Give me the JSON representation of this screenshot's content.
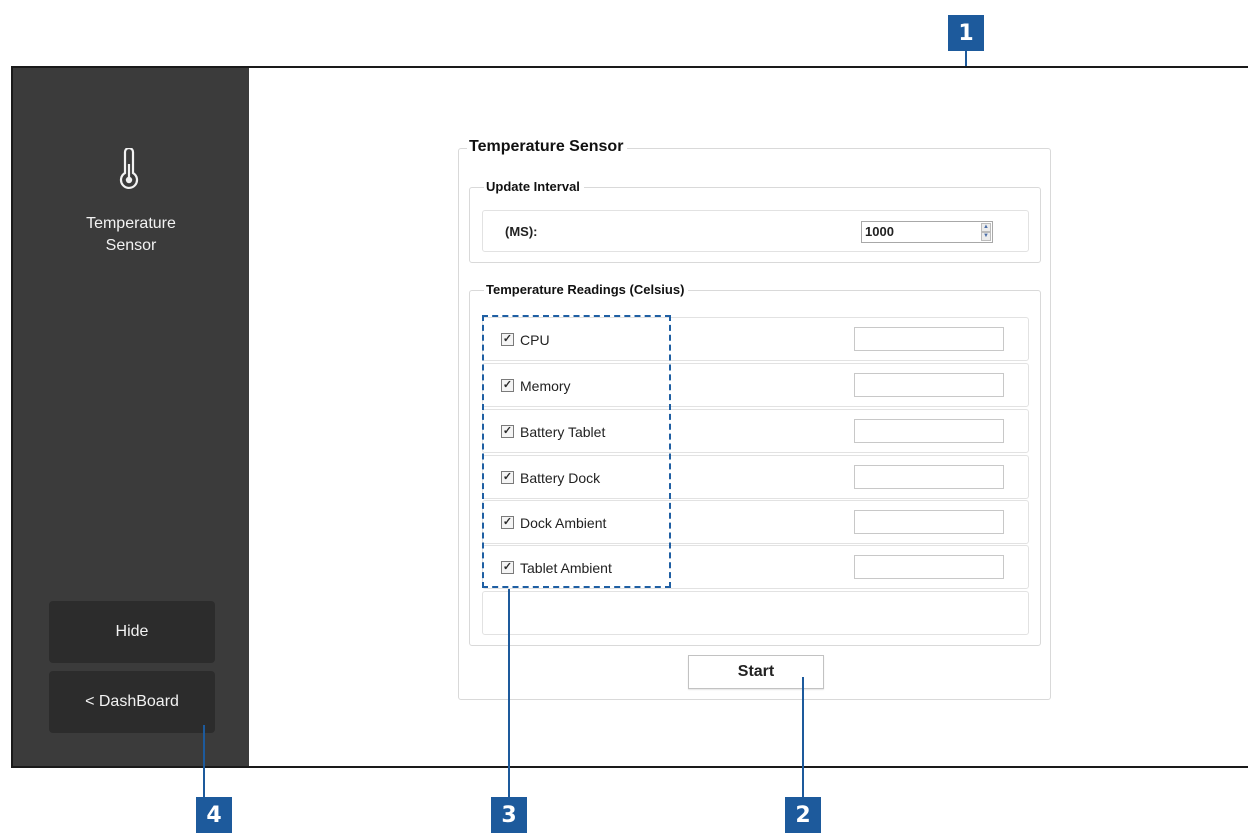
{
  "sidebar": {
    "app_title_line1": "Temperature",
    "app_title_line2": "Sensor",
    "icon": "thermometer-icon",
    "hide_label": "Hide",
    "dashboard_label": "< DashBoard"
  },
  "main": {
    "group_title": "Temperature Sensor",
    "update_interval": {
      "title": "Update Interval",
      "label": "(MS):",
      "value": "1000"
    },
    "readings": {
      "title": "Temperature Readings (Celsius)",
      "items": [
        {
          "label": "CPU",
          "checked": true,
          "value": ""
        },
        {
          "label": "Memory",
          "checked": true,
          "value": ""
        },
        {
          "label": "Battery Tablet",
          "checked": true,
          "value": ""
        },
        {
          "label": "Battery Dock",
          "checked": true,
          "value": ""
        },
        {
          "label": "Dock Ambient",
          "checked": true,
          "value": ""
        },
        {
          "label": "Tablet Ambient",
          "checked": true,
          "value": ""
        }
      ]
    },
    "start_label": "Start"
  },
  "callouts": [
    "1",
    "2",
    "3",
    "4"
  ],
  "colors": {
    "sidebar_bg": "#3b3b3b",
    "sidebar_button_bg": "#2c2c2c",
    "callout_blue": "#1d5a9c"
  }
}
